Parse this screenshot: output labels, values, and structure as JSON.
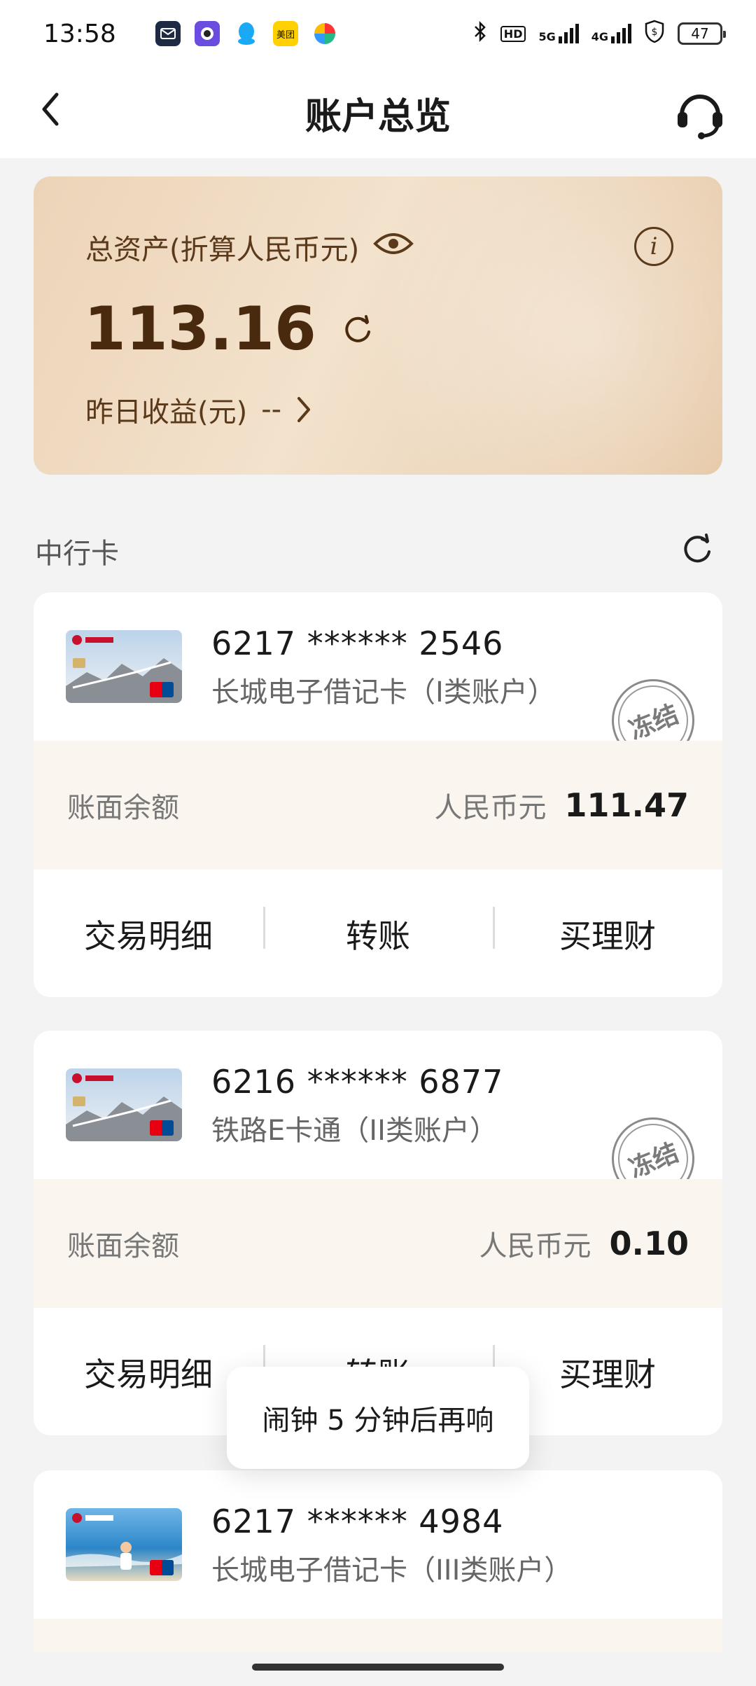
{
  "status_bar": {
    "time": "13:58",
    "apps": [
      {
        "name": "mail-icon",
        "color": "#1e2a44"
      },
      {
        "name": "camera-app-icon",
        "color": "#6a4de0"
      },
      {
        "name": "qq-icon",
        "color": "#19a9f5"
      },
      {
        "name": "meituan-icon",
        "color": "#ffd100",
        "text": "美团"
      },
      {
        "name": "pinwheel-app-icon",
        "color": "#ffffff"
      }
    ],
    "network": "5G",
    "network2": "4G",
    "hd_badge": "HD",
    "battery": "47"
  },
  "header": {
    "title": "账户总览"
  },
  "asset_card": {
    "label": "总资产(折算人民币元)",
    "amount": "113.16",
    "yesterday_label": "昨日收益(元)",
    "yesterday_value": "--",
    "info_glyph": "i"
  },
  "section": {
    "title": "中行卡"
  },
  "accounts": [
    {
      "number": "6217 ****** 2546",
      "type": "长城电子借记卡（I类账户）",
      "frozen": "冻结",
      "balance_label": "账面余额",
      "currency": "人民币元",
      "balance": "111.47",
      "actions": [
        "交易明细",
        "转账",
        "买理财"
      ],
      "thumb_style": "greatwall"
    },
    {
      "number": "6216 ****** 6877",
      "type": "铁路E卡通（II类账户）",
      "frozen": "冻结",
      "balance_label": "账面余额",
      "currency": "人民币元",
      "balance": "0.10",
      "actions": [
        "交易明细",
        "转账",
        "买理财"
      ],
      "thumb_style": "greatwall"
    },
    {
      "number": "6217 ****** 4984",
      "type": "长城电子借记卡（III类账户）",
      "thumb_style": "beach"
    }
  ],
  "toast": {
    "text": "闹钟 5 分钟后再响"
  }
}
